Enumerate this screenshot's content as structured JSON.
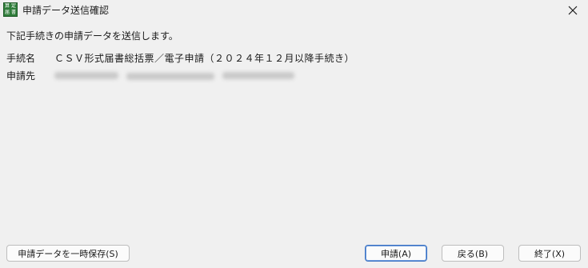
{
  "window": {
    "title": "申請データ送信確認",
    "app_icon": {
      "name": "app-icon",
      "chars": [
        "算",
        "定",
        "届",
        "書"
      ],
      "color": "#2f7d3a"
    },
    "close_icon": "close-icon"
  },
  "content": {
    "message": "下記手続きの申請データを送信します。",
    "procedure_label": "手続名",
    "procedure_value": "ＣＳＶ形式届書総括票／電子申請（２０２４年１２月以降手続き）",
    "destination_label": "申請先"
  },
  "buttons": {
    "save_temp": "申請データを一時保存(S)",
    "apply": "申請(A)",
    "back": "戻る(B)",
    "finish": "終了(X)"
  },
  "colors": {
    "background": "#f0f0f0",
    "primary_border": "#3b73c4"
  }
}
